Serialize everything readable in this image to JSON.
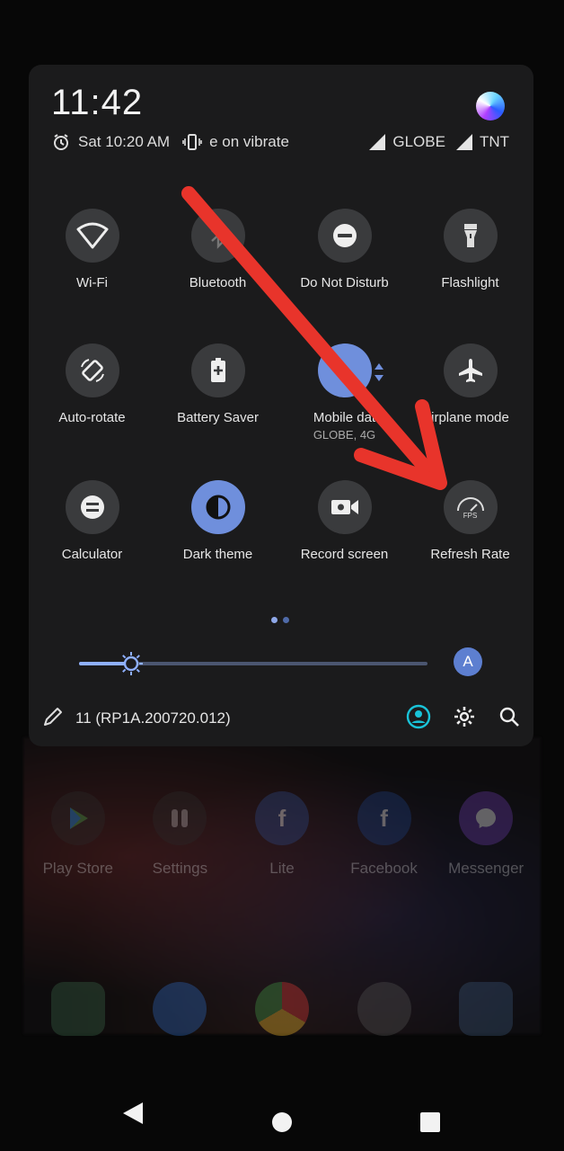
{
  "status": {
    "time": "11:42",
    "alarm": "Sat 10:20 AM",
    "ringer": "e on vibrate",
    "carrier1": "GLOBE",
    "carrier2": "TNT"
  },
  "tiles": [
    {
      "label": "Wi-Fi",
      "icon": "wifi-icon",
      "active": false
    },
    {
      "label": "Bluetooth",
      "icon": "bluetooth-icon",
      "active": false
    },
    {
      "label": "Do Not Disturb",
      "icon": "do-not-disturb-icon",
      "active": false
    },
    {
      "label": "Flashlight",
      "icon": "flashlight-icon",
      "active": false
    },
    {
      "label": "Auto-rotate",
      "icon": "auto-rotate-icon",
      "active": false
    },
    {
      "label": "Battery Saver",
      "icon": "battery-saver-icon",
      "active": false
    },
    {
      "label": "Mobile dat",
      "sublabel": "GLOBE, 4G",
      "icon": "mobile-data-icon",
      "active": true
    },
    {
      "label": "irplane mode",
      "icon": "airplane-icon",
      "active": false
    },
    {
      "label": "Calculator",
      "icon": "calculator-icon",
      "active": false
    },
    {
      "label": "Dark theme",
      "icon": "dark-theme-icon",
      "active": true
    },
    {
      "label": "Record screen",
      "icon": "record-screen-icon",
      "active": false
    },
    {
      "label": "Refresh Rate",
      "icon": "refresh-rate-icon",
      "badge": "FPS",
      "active": false
    }
  ],
  "brightness": {
    "level": 0.15,
    "auto_label": "A"
  },
  "footer": {
    "build": "11 (RP1A.200720.012)"
  },
  "home": {
    "row1": [
      {
        "label": "Play Store",
        "icon": "play-store-icon"
      },
      {
        "label": "Settings",
        "icon": "settings-app-icon"
      },
      {
        "label": "Lite",
        "icon": "facebook-lite-icon",
        "glyph": "f"
      },
      {
        "label": "Facebook",
        "icon": "facebook-icon",
        "glyph": "f"
      },
      {
        "label": "Messenger",
        "icon": "messenger-icon"
      }
    ],
    "row2": [
      {
        "icon": "contacts-icon"
      },
      {
        "icon": "messages-icon"
      },
      {
        "icon": "chrome-icon"
      },
      {
        "icon": "camera-icon"
      },
      {
        "icon": "gallery-icon"
      }
    ]
  },
  "colors": {
    "panel": "#1b1b1c",
    "tile_off": "#3a3b3d",
    "tile_on": "#6f8fdc",
    "annotation": "#e8342b"
  }
}
